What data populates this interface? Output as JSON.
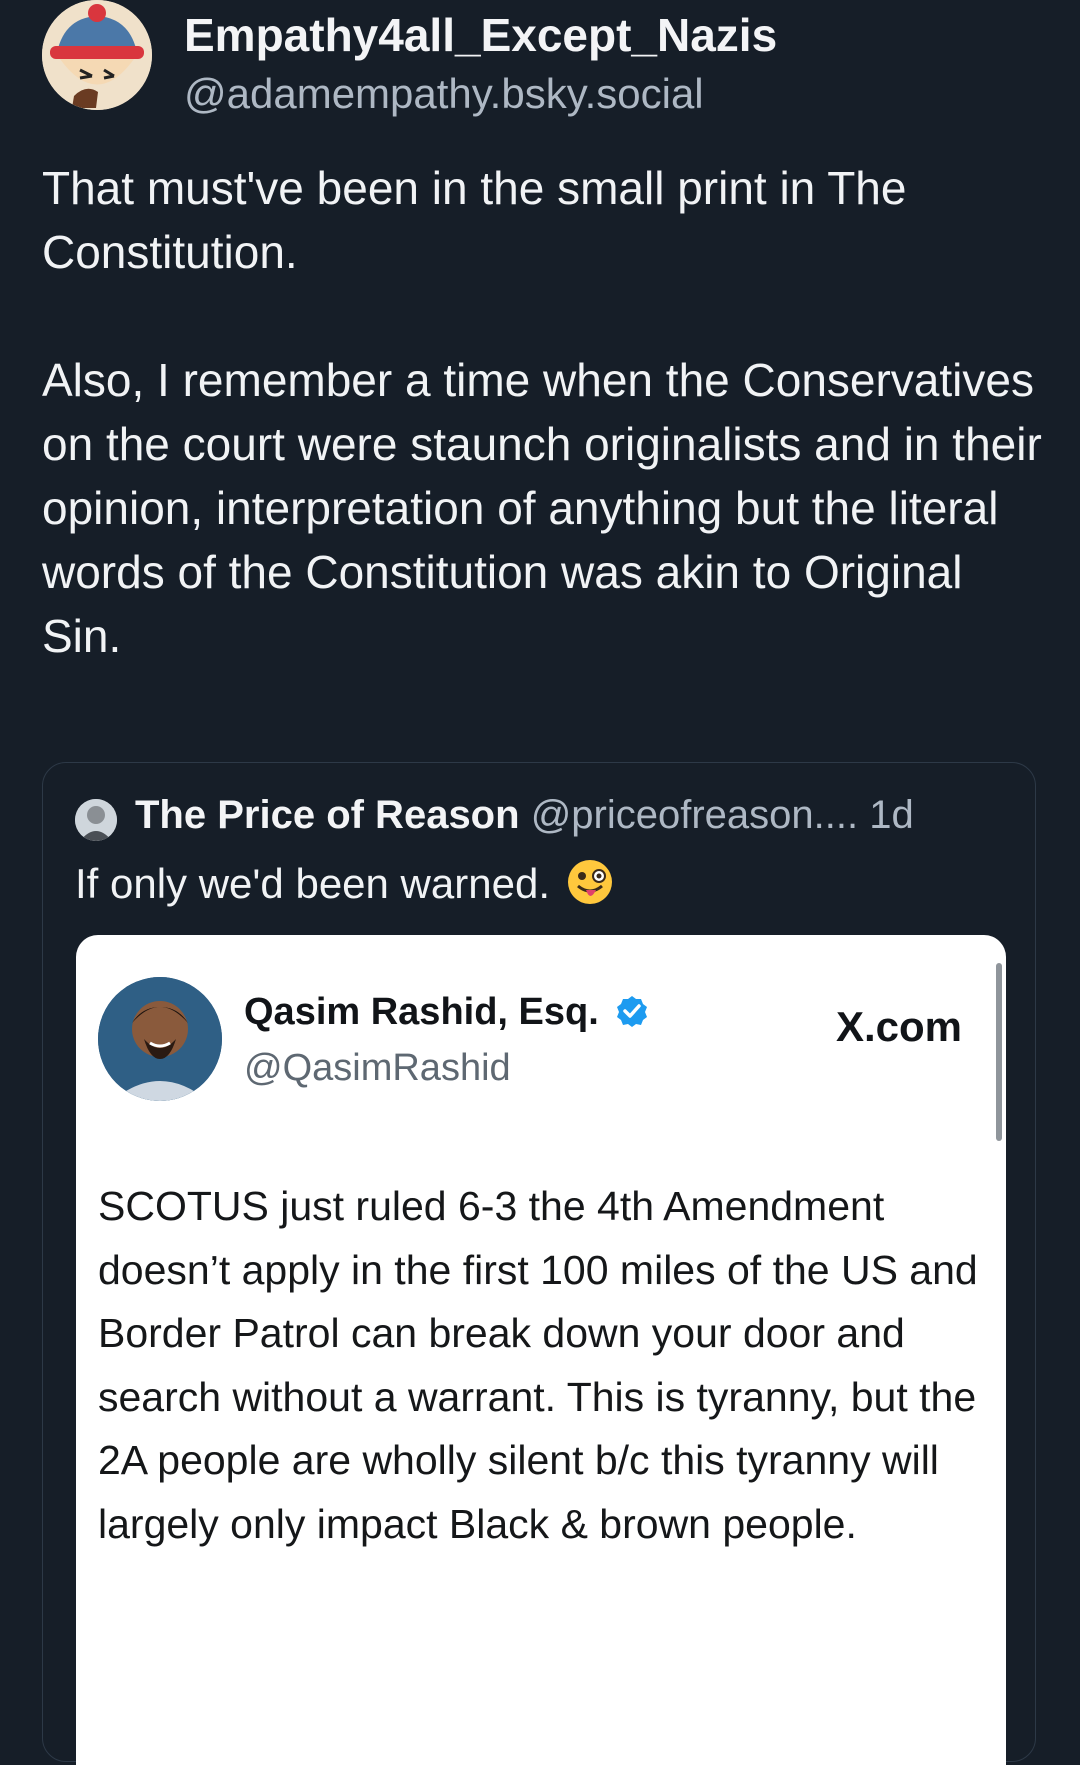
{
  "post": {
    "author_name": "Empathy4all_Except_Nazis",
    "author_handle": "@adamempathy.bsky.social",
    "text_p1": "That must've been in the small print in The Constitution.",
    "text_p2": "Also, I remember a time when the Conservatives on the court were staunch originalists and in their opinion, interpretation of anything but the literal words of the Constitution was akin to Original Sin."
  },
  "quote": {
    "author_name": "The Price of Reason",
    "author_handle": "@priceofreason....",
    "time": "1d",
    "text": "If only we'd been warned.",
    "emoji": "winking-face-with-tongue-icon"
  },
  "embed": {
    "author_name": "Qasim Rashid, Esq.",
    "author_handle": "@QasimRashid",
    "source": "X.com",
    "verified_color": "#1d9bf0",
    "text": "SCOTUS just ruled 6-3 the 4th Amendment doesn’t apply in the first 100 miles of the US and Border Patrol can break down your door and search without a warrant. This is tyranny, but the 2A people are wholly silent b/c this tyranny will largely only impact Black & brown people."
  },
  "colors": {
    "background": "#161e28",
    "text_primary": "#f1f3f5",
    "text_secondary": "#aeb8c4",
    "quote_border": "#2d3947"
  }
}
